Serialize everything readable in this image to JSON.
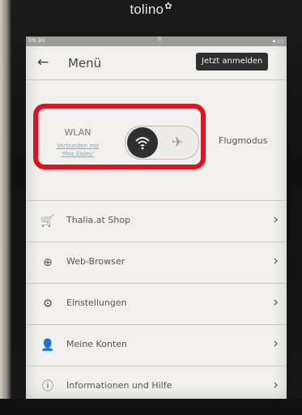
{
  "device": {
    "brand": "tolino",
    "brand_mark": "✿"
  },
  "status": {
    "time": "09:30",
    "light_icon": "sun-icon",
    "battery": "◂ ▭"
  },
  "header": {
    "back_glyph": "←",
    "title": "Menü",
    "login_label": "Jetzt anmelden"
  },
  "wlan": {
    "label": "WLAN",
    "sub_line1": "Verbunden mit",
    "sub_line2": "'Mos Eisley'",
    "plane_glyph": "✈",
    "airplane_label": "Flugmodus",
    "highlight_color": "#e8101c"
  },
  "menu": {
    "items": [
      {
        "label": "Thalia.at Shop",
        "icon": "shopping-cart-icon",
        "glyph": "🛒"
      },
      {
        "label": "Web-Browser",
        "icon": "globe-icon",
        "glyph": "⊕"
      },
      {
        "label": "Einstellungen",
        "icon": "gear-icon",
        "glyph": "⚙"
      },
      {
        "label": "Meine Konten",
        "icon": "user-icon",
        "glyph": "👤"
      },
      {
        "label": "Informationen und Hilfe",
        "icon": "info-icon",
        "glyph": "ⓘ"
      }
    ],
    "chevron": "›"
  }
}
